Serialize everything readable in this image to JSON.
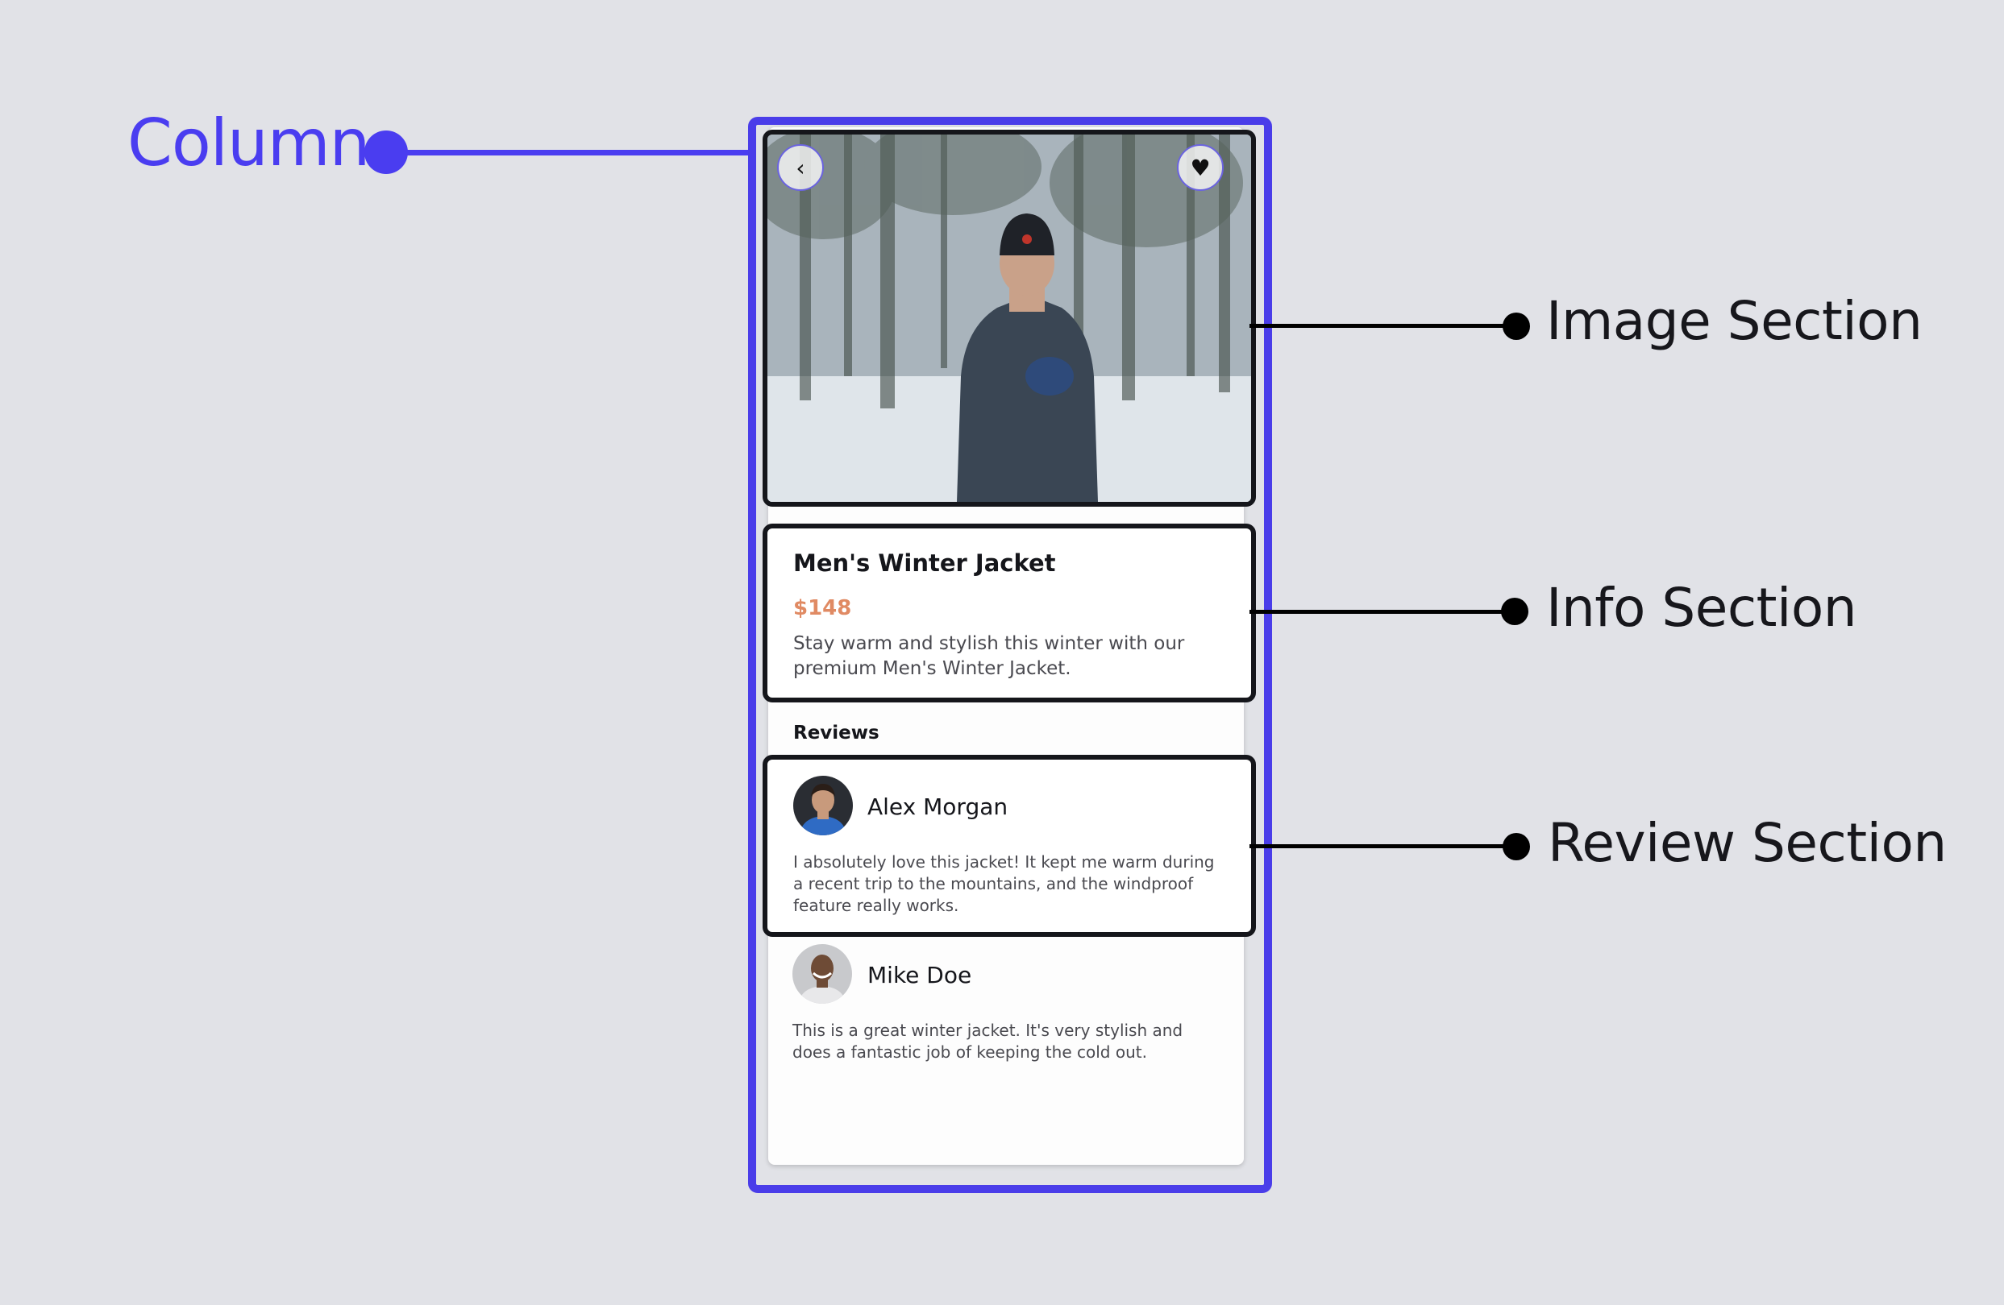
{
  "callouts": {
    "column": "Column",
    "image_section": "Image Section",
    "info_section": "Info Section",
    "review_section": "Review Section"
  },
  "colors": {
    "accent": "#4a3de9",
    "outline": "#15161b",
    "price": "#e08a63",
    "background": "#e1e2e7"
  },
  "product": {
    "title": "Men's Winter Jacket",
    "price": "$148",
    "description": "Stay warm and stylish this winter with our premium Men's Winter Jacket."
  },
  "image_buttons": {
    "back_icon": "chevron-left-icon",
    "favorite_icon": "heart-icon"
  },
  "reviews": {
    "heading": "Reviews",
    "items": [
      {
        "name": "Alex Morgan",
        "text": "I absolutely love this jacket! It kept me warm during a recent trip to the mountains, and the windproof feature really works."
      },
      {
        "name": "Mike Doe",
        "text": "This is a great winter jacket. It's very stylish and does a fantastic job of keeping the cold out."
      }
    ]
  }
}
